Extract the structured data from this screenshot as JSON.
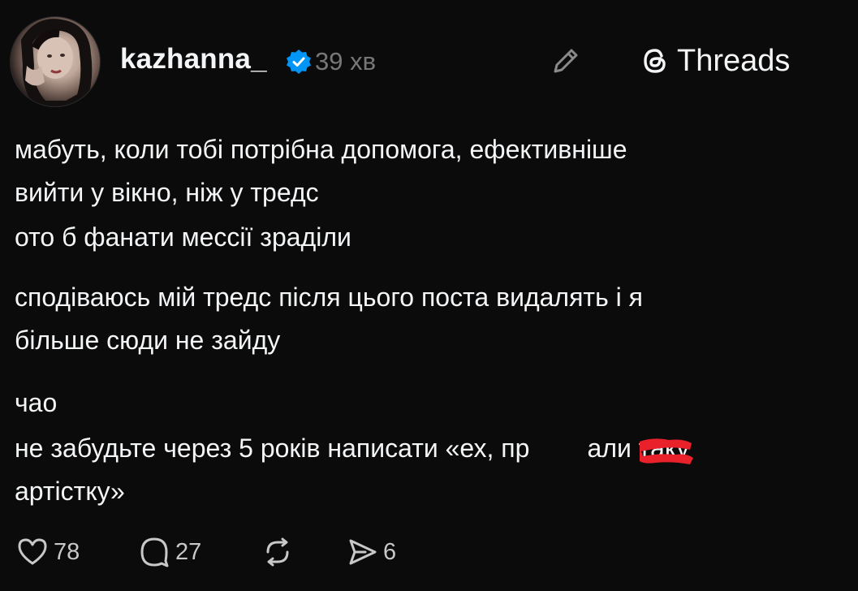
{
  "post": {
    "username": "kazhanna_",
    "time": "39 хв",
    "brand": "Threads",
    "paragraphs": [
      "мабуть, коли тобі потрібна допомога, ефективніше\nвийти у вікно, ніж у тредс",
      "ото б фанати мессії зраділи",
      "сподіваюсь мій тредс після цього поста видалять і я\nбільше сюди не зайду",
      "чао",
      "не забудьте через 5 років написати «ех, пр        али таку\nартістку»"
    ]
  },
  "actions": {
    "likes": "78",
    "comments": "27",
    "shares": "6"
  },
  "colors": {
    "background": "#0b0b0b",
    "text": "#f3f5f7",
    "muted": "#777777",
    "verified": "#0095f6",
    "redaction": "#e8212b"
  },
  "icons": [
    "verified-badge-icon",
    "pencil-icon",
    "threads-logo-icon",
    "heart-icon",
    "comment-icon",
    "repost-icon",
    "send-icon"
  ]
}
